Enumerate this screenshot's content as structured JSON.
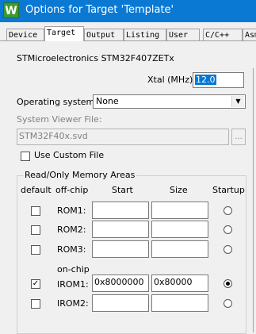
{
  "window": {
    "title": "Options for Target 'Template'",
    "icon": "keil-uvision-icon"
  },
  "tabs": [
    "Device",
    "Target",
    "Output",
    "Listing",
    "User",
    "C/C++",
    "Asm"
  ],
  "active_tab": "Target",
  "device_name": "STMicroelectronics STM32F407ZETx",
  "xtal": {
    "label": "Xtal (MHz):",
    "value": "12.0"
  },
  "os": {
    "label": "Operating system:",
    "value": "None"
  },
  "svd": {
    "label": "System Viewer File:",
    "value": "STM32F40x.svd",
    "browse": "...",
    "custom_label": "Use Custom File",
    "custom_checked": false
  },
  "rom_group": {
    "title": "Read/Only Memory Areas",
    "headers": {
      "default": "default",
      "offchip": "off-chip",
      "start": "Start",
      "size": "Size",
      "startup": "Startup"
    },
    "onchip_label": "on-chip",
    "rows": [
      {
        "label": "ROM1:",
        "default": false,
        "start": "",
        "size": "",
        "startup": false
      },
      {
        "label": "ROM2:",
        "default": false,
        "start": "",
        "size": "",
        "startup": false
      },
      {
        "label": "ROM3:",
        "default": false,
        "start": "",
        "size": "",
        "startup": false
      },
      {
        "label": "IROM1:",
        "default": true,
        "start": "0x8000000",
        "size": "0x80000",
        "startup": true
      },
      {
        "label": "IROM2:",
        "default": false,
        "start": "",
        "size": "",
        "startup": false
      }
    ]
  }
}
